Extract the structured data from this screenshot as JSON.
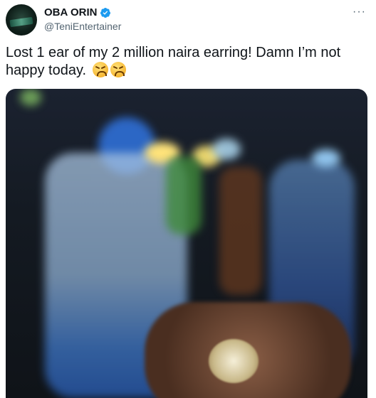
{
  "tweet": {
    "display_name": "OBA ORIN",
    "handle": "@TeniEntertainer",
    "text": "Lost 1 ear of my 2 million naira earring! Damn I’m not happy today.",
    "emojis": [
      "tired-face",
      "tired-face"
    ],
    "verified": true,
    "more_icon": "···"
  },
  "colors": {
    "verified_badge": "#1d9bf0",
    "secondary_text": "#536471",
    "primary_text": "#0f1419"
  }
}
